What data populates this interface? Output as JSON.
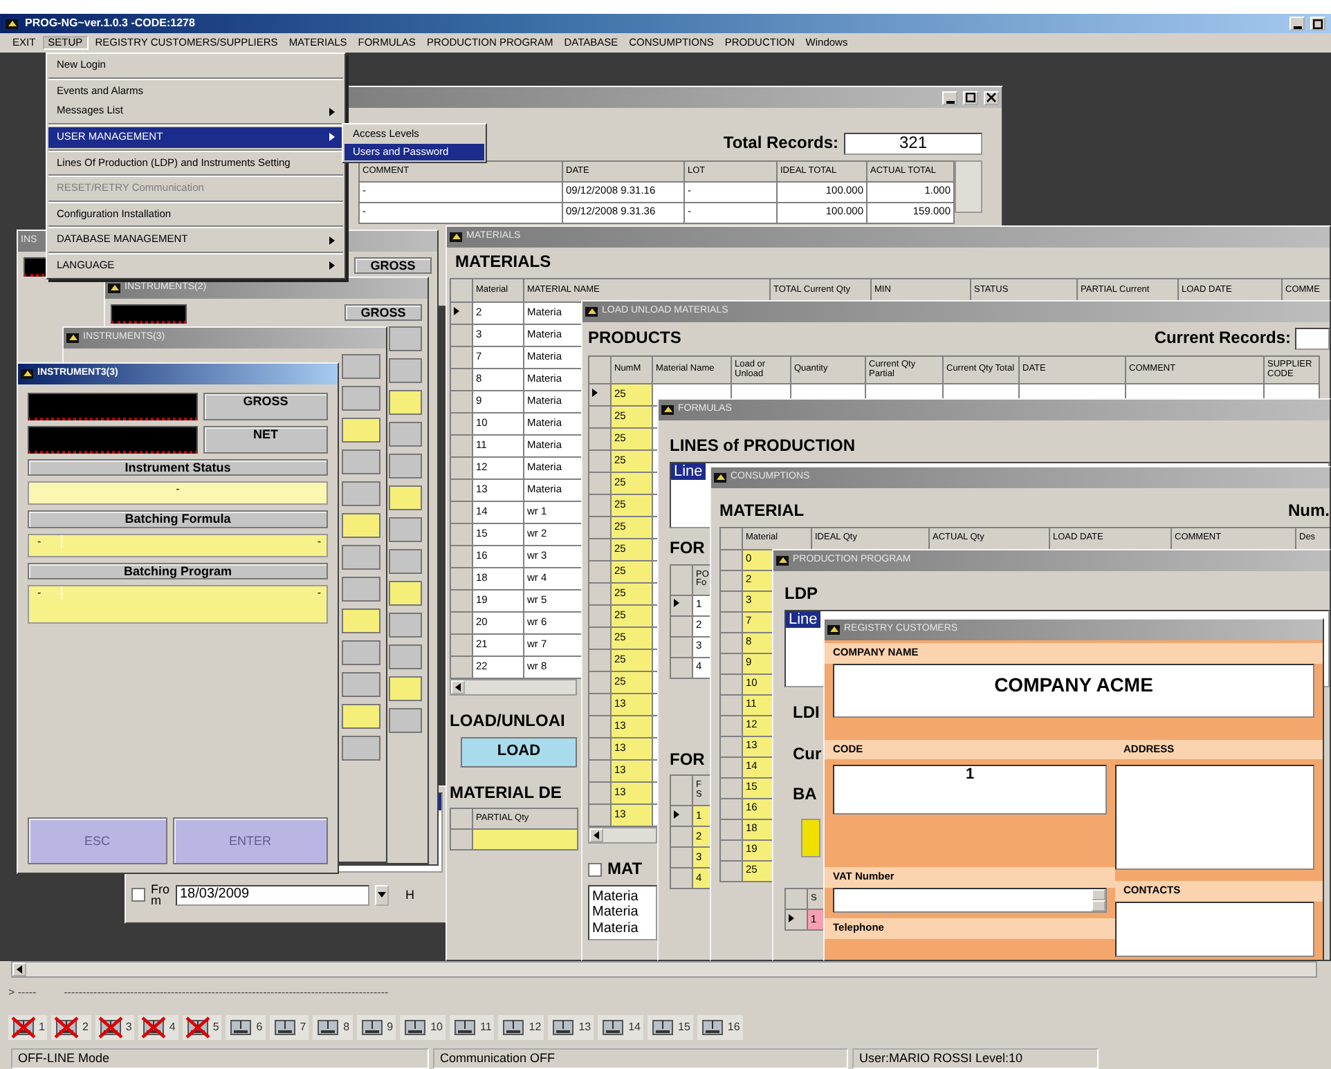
{
  "window": {
    "title": "PROG-NG~ver.1.0.3 -CODE:1278"
  },
  "menu_bar": [
    {
      "label": "EXIT",
      "selected": false
    },
    {
      "label": "SETUP",
      "selected": true
    },
    {
      "label": "REGISTRY CUSTOMERS/SUPPLIERS",
      "selected": false
    },
    {
      "label": "MATERIALS",
      "selected": false
    },
    {
      "label": "FORMULAS",
      "selected": false
    },
    {
      "label": "PRODUCTION PROGRAM",
      "selected": false
    },
    {
      "label": "DATABASE",
      "selected": false
    },
    {
      "label": "CONSUMPTIONS",
      "selected": false
    },
    {
      "label": "PRODUCTION",
      "selected": false
    },
    {
      "label": "Windows",
      "selected": false
    }
  ],
  "setup_menu": {
    "groups": [
      [
        {
          "label": "New Login",
          "selected": false,
          "disabled": false
        }
      ],
      [
        {
          "label": "Events and Alarms",
          "selected": false,
          "disabled": false
        },
        {
          "label": "Messages List",
          "submenu": true,
          "selected": false,
          "disabled": false
        }
      ],
      [
        {
          "label": "USER MANAGEMENT",
          "submenu": true,
          "selected": true,
          "disabled": false
        }
      ],
      [
        {
          "label": "Lines Of Production (LDP) and Instruments Setting",
          "selected": false,
          "disabled": false
        }
      ],
      [
        {
          "label": "RESET/RETRY Communication",
          "selected": false,
          "disabled": true
        }
      ],
      [
        {
          "label": "Configuration Installation",
          "selected": false,
          "disabled": false
        }
      ],
      [
        {
          "label": "DATABASE MANAGEMENT",
          "submenu": true,
          "selected": false,
          "disabled": false
        }
      ],
      [
        {
          "label": "LANGUAGE",
          "submenu": true,
          "selected": false,
          "disabled": false
        }
      ]
    ]
  },
  "user_management_submenu": [
    {
      "label": "Access Levels",
      "selected": false
    },
    {
      "label": "Users and Password",
      "selected": true
    }
  ],
  "records_window": {
    "active": false,
    "total_label": "Total Records:",
    "total": "321",
    "columns": [
      "COMMENT",
      "DATE",
      "LOT",
      "IDEAL TOTAL",
      "ACTUAL TOTAL"
    ],
    "rows": [
      {
        "cells": [
          "-",
          "09/12/2008 9.31.16",
          "-",
          "100.000",
          "1.000"
        ]
      },
      {
        "cells": [
          "-",
          "09/12/2008 9.31.36",
          "-",
          "100.000",
          "159.000"
        ]
      }
    ]
  },
  "date_filter": {
    "checkbox_label": "From",
    "checked": false,
    "date": "18/03/2009",
    "label_after": "H"
  },
  "instrument_windows_behind": [
    {
      "title": "INS",
      "active": false,
      "gross": "GROSS"
    },
    {
      "title": "INSTRUMENTS(2)",
      "active": false,
      "gross": "GROSS"
    },
    {
      "title": "INSTRUMENTS(3)",
      "active": false
    }
  ],
  "instrument_window": {
    "title": "INSTRUMENT3(3)",
    "active": true,
    "displays": [
      {
        "button": "GROSS"
      },
      {
        "button": "NET"
      }
    ],
    "status_label": "Instrument Status",
    "status_value": "-",
    "formula_label": "Batching Formula",
    "formula_values": [
      "-",
      "-"
    ],
    "program_label": "Batching Program",
    "program_values": [
      "-",
      "-"
    ],
    "buttons": [
      {
        "label": "ESC",
        "disabled": true
      },
      {
        "label": "ENTER",
        "disabled": true
      }
    ]
  },
  "materials_window": {
    "title": "MATERIALS",
    "active": false,
    "heading": "MATERIALS",
    "columns": [
      "Material",
      "MATERIAL NAME",
      "TOTAL Current Qty",
      "MIN",
      "STATUS",
      "PARTIAL Current",
      "LOAD DATE",
      "COMME"
    ],
    "rows": [
      {
        "cells": [
          "2",
          "Materia"
        ],
        "selected": true
      },
      {
        "cells": [
          "3",
          "Materia"
        ],
        "selected": false
      },
      {
        "cells": [
          "7",
          "Materia"
        ],
        "selected": false
      },
      {
        "cells": [
          "8",
          "Materia"
        ],
        "selected": false
      },
      {
        "cells": [
          "9",
          "Materia"
        ],
        "selected": false
      },
      {
        "cells": [
          "10",
          "Materia"
        ],
        "selected": false
      },
      {
        "cells": [
          "11",
          "Materia"
        ],
        "selected": false
      },
      {
        "cells": [
          "12",
          "Materia"
        ],
        "selected": false
      },
      {
        "cells": [
          "13",
          "Materia"
        ],
        "selected": false
      },
      {
        "cells": [
          "14",
          "wr 1"
        ],
        "selected": false
      },
      {
        "cells": [
          "15",
          "wr 2"
        ],
        "selected": false
      },
      {
        "cells": [
          "16",
          "wr 3"
        ],
        "selected": false
      },
      {
        "cells": [
          "18",
          "wr 4"
        ],
        "selected": false
      },
      {
        "cells": [
          "19",
          "wr 5"
        ],
        "selected": false
      },
      {
        "cells": [
          "20",
          "wr 6"
        ],
        "selected": false
      },
      {
        "cells": [
          "21",
          "wr 7"
        ],
        "selected": false
      },
      {
        "cells": [
          "22",
          "wr 8"
        ],
        "selected": false
      }
    ],
    "load_heading": "LOAD/UNLOAI",
    "load_button": "LOAD",
    "detail_heading": "MATERIAL DE",
    "detail_columns": [
      "PARTIAL Qty"
    ]
  },
  "load_unload_window": {
    "title": "LOAD UNLOAD MATERIALS",
    "active": false,
    "heading": "PRODUCTS",
    "records_label": "Current Records:",
    "columns": [
      "NumM",
      "Material Name",
      "Load or Unload",
      "Quantity",
      "Current Qty Partial",
      "Current Qty Total",
      "DATE",
      "COMMENT",
      "SUPPLIER CODE"
    ],
    "rows": [
      {
        "cells": [
          "25"
        ],
        "selected": true
      },
      {
        "cells": [
          "25"
        ],
        "selected": false
      },
      {
        "cells": [
          "25"
        ],
        "selected": false
      },
      {
        "cells": [
          "25"
        ],
        "selected": false
      },
      {
        "cells": [
          "25"
        ],
        "selected": false
      },
      {
        "cells": [
          "25"
        ],
        "selected": false
      },
      {
        "cells": [
          "25"
        ],
        "selected": false
      },
      {
        "cells": [
          "25"
        ],
        "selected": false
      },
      {
        "cells": [
          "25"
        ],
        "selected": false
      },
      {
        "cells": [
          "25"
        ],
        "selected": false
      },
      {
        "cells": [
          "25"
        ],
        "selected": false
      },
      {
        "cells": [
          "25"
        ],
        "selected": false
      },
      {
        "cells": [
          "25"
        ],
        "selected": false
      },
      {
        "cells": [
          "25"
        ],
        "selected": false
      },
      {
        "cells": [
          "13"
        ],
        "selected": false
      },
      {
        "cells": [
          "13"
        ],
        "selected": false
      },
      {
        "cells": [
          "13"
        ],
        "selected": false
      },
      {
        "cells": [
          "13"
        ],
        "selected": false
      },
      {
        "cells": [
          "13"
        ],
        "selected": false
      },
      {
        "cells": [
          "13"
        ],
        "selected": false
      }
    ],
    "filter_label": "MAT",
    "filter_checked": false,
    "list": [
      "Materia",
      "Materia",
      "Materia"
    ]
  },
  "formulas_window": {
    "title": "FORMULAS",
    "active": false,
    "heading": "LINES of PRODUCTION",
    "lines": [
      {
        "label": "Line",
        "selected": true
      }
    ],
    "formula_heading": "FOR",
    "formula_columns": [
      "PO Fo"
    ],
    "formula_rows": [
      {
        "cells": [
          "1"
        ],
        "selected": true
      },
      {
        "cells": [
          "2"
        ],
        "selected": false
      },
      {
        "cells": [
          "3"
        ],
        "selected": false
      },
      {
        "cells": [
          "4"
        ],
        "selected": false
      }
    ],
    "second_heading": "FOR",
    "second_columns": [
      "F S"
    ],
    "second_rows": [
      {
        "cells": [
          "1"
        ],
        "selected": true
      },
      {
        "cells": [
          "2"
        ],
        "selected": false
      },
      {
        "cells": [
          "3"
        ],
        "selected": false
      },
      {
        "cells": [
          "4"
        ],
        "selected": false
      }
    ]
  },
  "consumptions_window": {
    "title": "CONSUMPTIONS",
    "active": false,
    "heading": "MATERIAL",
    "count_label": "Num.",
    "columns": [
      "Material",
      "IDEAL Qty",
      "ACTUAL Qty",
      "LOAD DATE",
      "COMMENT",
      "Des"
    ],
    "rows": [
      {
        "cells": [
          "0"
        ]
      },
      {
        "cells": [
          "2"
        ]
      },
      {
        "cells": [
          "3"
        ]
      },
      {
        "cells": [
          "7"
        ]
      },
      {
        "cells": [
          "8"
        ]
      },
      {
        "cells": [
          "9"
        ]
      },
      {
        "cells": [
          "10"
        ]
      },
      {
        "cells": [
          "11"
        ]
      },
      {
        "cells": [
          "12"
        ]
      },
      {
        "cells": [
          "13"
        ]
      },
      {
        "cells": [
          "14"
        ]
      },
      {
        "cells": [
          "15"
        ]
      },
      {
        "cells": [
          "16"
        ]
      },
      {
        "cells": [
          "18"
        ]
      },
      {
        "cells": [
          "19"
        ]
      },
      {
        "cells": [
          "25"
        ]
      }
    ]
  },
  "production_program_window": {
    "title": "PRODUCTION PROGRAM",
    "active": false,
    "heading": "LDP",
    "lines": [
      {
        "label": "Line",
        "selected": true
      }
    ],
    "labels": [
      "LDI",
      "Cur",
      "BA"
    ],
    "table_columns": [
      "S"
    ],
    "table_rows": [
      {
        "cells": [
          "1"
        ],
        "selected": true
      }
    ]
  },
  "registry_customers_window": {
    "title": "REGISTRY CUSTOMERS",
    "active": false,
    "company_name_label": "COMPANY NAME",
    "company_name": "COMPANY ACME",
    "code_label": "CODE",
    "code": "1",
    "address_label": "ADDRESS",
    "vat_label": "VAT Number",
    "contacts_label": "CONTACTS",
    "telephone_label": "Telephone"
  },
  "command_line": {
    "prompt": "> -----",
    "output": "----------------------------------------------------------------------------------------"
  },
  "instruments": [
    {
      "number": "1",
      "offline": true
    },
    {
      "number": "2",
      "offline": true
    },
    {
      "number": "3",
      "offline": true
    },
    {
      "number": "4",
      "offline": true
    },
    {
      "number": "5",
      "offline": true
    },
    {
      "number": "6",
      "offline": false
    },
    {
      "number": "7",
      "offline": false
    },
    {
      "number": "8",
      "offline": false
    },
    {
      "number": "9",
      "offline": false
    },
    {
      "number": "10",
      "offline": false
    },
    {
      "number": "11",
      "offline": false
    },
    {
      "number": "12",
      "offline": false
    },
    {
      "number": "13",
      "offline": false
    },
    {
      "number": "14",
      "offline": false
    },
    {
      "number": "15",
      "offline": false
    },
    {
      "number": "16",
      "offline": false
    }
  ],
  "status_bar": [
    "OFF-LINE Mode",
    "Communication OFF",
    "User:MARIO ROSSI Level:10"
  ]
}
